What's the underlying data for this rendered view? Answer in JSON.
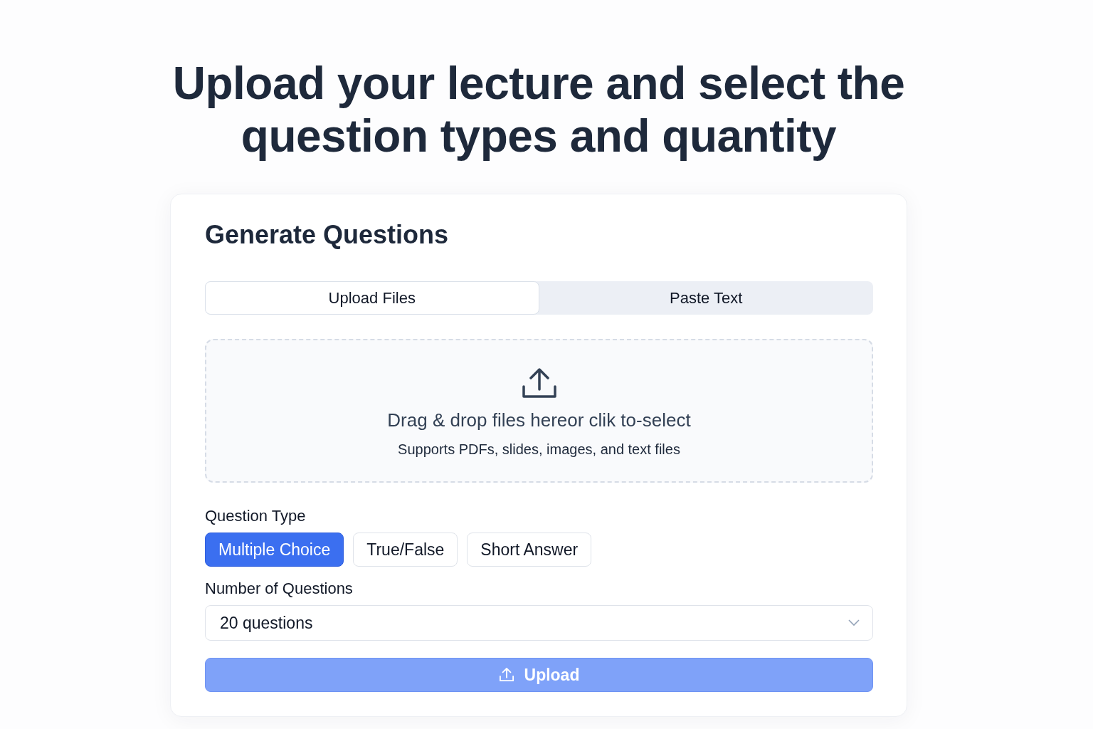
{
  "heading": "Upload your lecture and select the question types and quantity",
  "card": {
    "title": "Generate Questions"
  },
  "tabs": [
    {
      "label": "Upload Files",
      "selected": true
    },
    {
      "label": "Paste Text",
      "selected": false
    }
  ],
  "dropzone": {
    "text": "Drag & drop files hereor clik to-select",
    "hint": "Supports PDFs, slides, images, and text files"
  },
  "question_type": {
    "label": "Question Type",
    "options": [
      {
        "label": "Multiple Choice",
        "selected": true
      },
      {
        "label": "True/False",
        "selected": false
      },
      {
        "label": "Short Answer",
        "selected": false
      }
    ]
  },
  "quantity": {
    "label": "Number of Questions",
    "value": "20 questions"
  },
  "submit": {
    "label": "Upload",
    "disabled": true
  }
}
